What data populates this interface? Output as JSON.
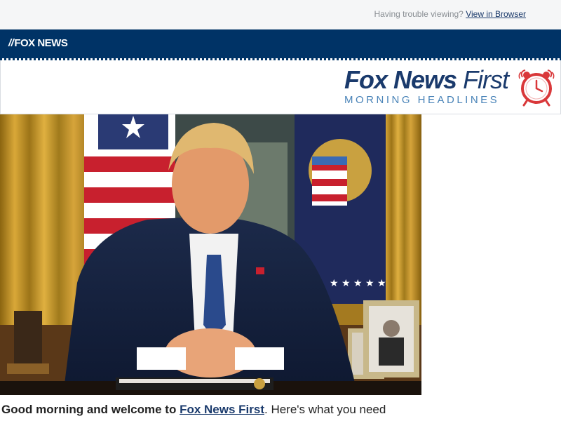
{
  "header": {
    "trouble_text": "Having trouble viewing?",
    "view_link": "View in Browser"
  },
  "nav": {
    "logo_slash": "//",
    "logo_text": "FOX NEWS"
  },
  "masthead": {
    "title_bold": "Fox News",
    "title_light": "First",
    "subtitle": "MORNING HEADLINES"
  },
  "intro": {
    "greeting": "Good morning and welcome to",
    "link": "Fox News First",
    "rest": ". Here's what you need"
  },
  "colors": {
    "navy": "#003366",
    "brand_blue": "#1a3a6c",
    "sub_blue": "#4a84b8",
    "clock_red": "#d9383a"
  },
  "icons": {
    "clock": "alarm-clock-icon"
  }
}
